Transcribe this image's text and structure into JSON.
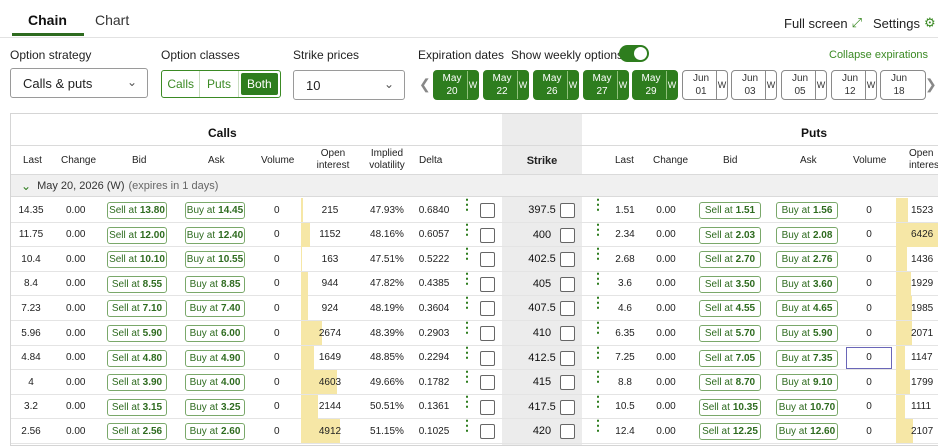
{
  "tabs": [
    {
      "label": "Chain"
    },
    {
      "label": "Chart"
    }
  ],
  "header": {
    "fullscreen_label": "Full screen",
    "settings_label": "Settings"
  },
  "controls": {
    "option_strategy_label": "Option strategy",
    "option_strategy_value": "Calls & puts",
    "option_classes_label": "Option classes",
    "classes": [
      "Calls",
      "Puts",
      "Both"
    ],
    "strike_prices_label": "Strike prices",
    "strike_prices_value": "10",
    "expiration_dates_label": "Expiration dates",
    "weekly_label": "Show weekly options",
    "collapse_label": "Collapse expirations"
  },
  "expirations": [
    {
      "m": "May",
      "d": "20",
      "w": "W",
      "selected": true
    },
    {
      "m": "May",
      "d": "22",
      "w": "W",
      "selected": true
    },
    {
      "m": "May",
      "d": "26",
      "w": "W",
      "selected": true
    },
    {
      "m": "May",
      "d": "27",
      "w": "W",
      "selected": true
    },
    {
      "m": "May",
      "d": "29",
      "w": "W",
      "selected": true
    },
    {
      "m": "Jun",
      "d": "01",
      "w": "W",
      "selected": false
    },
    {
      "m": "Jun",
      "d": "03",
      "w": "W",
      "selected": false
    },
    {
      "m": "Jun",
      "d": "05",
      "w": "W",
      "selected": false
    },
    {
      "m": "Jun",
      "d": "12",
      "w": "W",
      "selected": false
    },
    {
      "m": "Jun",
      "d": "18",
      "w": "",
      "selected": false
    }
  ],
  "table": {
    "calls_label": "Calls",
    "puts_label": "Puts",
    "headers": {
      "last": "Last",
      "change": "Change",
      "bid": "Bid",
      "ask": "Ask",
      "volume": "Volume",
      "oi_1": "Open",
      "oi_2": "interest",
      "iv_1": "Implied",
      "iv_2": "volatility",
      "delta": "Delta",
      "strike": "Strike",
      "p_last": "Last",
      "p_change": "Change",
      "p_bid": "Bid",
      "p_ask": "Ask",
      "p_volume": "Volume",
      "p_oi_1": "Open",
      "p_oi_2": "interest"
    },
    "expiry_title": "May 20, 2026 (W)",
    "expiry_note": "(expires in 1 days)",
    "sell_prefix": "Sell at",
    "buy_prefix": "Buy at",
    "rows": [
      {
        "c_last": "14.35",
        "c_chg": "0.00",
        "c_bid": "13.80",
        "c_ask": "14.45",
        "c_vol": "0",
        "c_oi": "215",
        "c_iv": "47.93%",
        "c_delta": "0.6840",
        "strike": "397.5",
        "p_last": "1.51",
        "p_chg": "0.00",
        "p_bid": "1.51",
        "p_ask": "1.56",
        "p_vol": "0",
        "p_oi": "1523"
      },
      {
        "c_last": "11.75",
        "c_chg": "0.00",
        "c_bid": "12.00",
        "c_ask": "12.40",
        "c_vol": "0",
        "c_oi": "1152",
        "c_iv": "48.16%",
        "c_delta": "0.6057",
        "strike": "400",
        "p_last": "2.34",
        "p_chg": "0.00",
        "p_bid": "2.03",
        "p_ask": "2.08",
        "p_vol": "0",
        "p_oi": "6426"
      },
      {
        "c_last": "10.4",
        "c_chg": "0.00",
        "c_bid": "10.10",
        "c_ask": "10.55",
        "c_vol": "0",
        "c_oi": "163",
        "c_iv": "47.51%",
        "c_delta": "0.5222",
        "strike": "402.5",
        "p_last": "2.68",
        "p_chg": "0.00",
        "p_bid": "2.70",
        "p_ask": "2.76",
        "p_vol": "0",
        "p_oi": "1436"
      },
      {
        "c_last": "8.4",
        "c_chg": "0.00",
        "c_bid": "8.55",
        "c_ask": "8.85",
        "c_vol": "0",
        "c_oi": "944",
        "c_iv": "47.82%",
        "c_delta": "0.4385",
        "strike": "405",
        "p_last": "3.6",
        "p_chg": "0.00",
        "p_bid": "3.50",
        "p_ask": "3.60",
        "p_vol": "0",
        "p_oi": "1929"
      },
      {
        "c_last": "7.23",
        "c_chg": "0.00",
        "c_bid": "7.10",
        "c_ask": "7.40",
        "c_vol": "0",
        "c_oi": "924",
        "c_iv": "48.19%",
        "c_delta": "0.3604",
        "strike": "407.5",
        "p_last": "4.6",
        "p_chg": "0.00",
        "p_bid": "4.55",
        "p_ask": "4.65",
        "p_vol": "0",
        "p_oi": "1985"
      },
      {
        "c_last": "5.96",
        "c_chg": "0.00",
        "c_bid": "5.90",
        "c_ask": "6.00",
        "c_vol": "0",
        "c_oi": "2674",
        "c_iv": "48.39%",
        "c_delta": "0.2903",
        "strike": "410",
        "p_last": "6.35",
        "p_chg": "0.00",
        "p_bid": "5.70",
        "p_ask": "5.90",
        "p_vol": "0",
        "p_oi": "2071"
      },
      {
        "c_last": "4.84",
        "c_chg": "0.00",
        "c_bid": "4.80",
        "c_ask": "4.90",
        "c_vol": "0",
        "c_oi": "1649",
        "c_iv": "48.85%",
        "c_delta": "0.2294",
        "strike": "412.5",
        "p_last": "7.25",
        "p_chg": "0.00",
        "p_bid": "7.05",
        "p_ask": "7.35",
        "p_vol": "0",
        "p_oi": "1147"
      },
      {
        "c_last": "4",
        "c_chg": "0.00",
        "c_bid": "3.90",
        "c_ask": "4.00",
        "c_vol": "0",
        "c_oi": "4603",
        "c_iv": "49.66%",
        "c_delta": "0.1782",
        "strike": "415",
        "p_last": "8.8",
        "p_chg": "0.00",
        "p_bid": "8.70",
        "p_ask": "9.10",
        "p_vol": "0",
        "p_oi": "1799"
      },
      {
        "c_last": "3.2",
        "c_chg": "0.00",
        "c_bid": "3.15",
        "c_ask": "3.25",
        "c_vol": "0",
        "c_oi": "2144",
        "c_iv": "50.51%",
        "c_delta": "0.1361",
        "strike": "417.5",
        "p_last": "10.5",
        "p_chg": "0.00",
        "p_bid": "10.35",
        "p_ask": "10.70",
        "p_vol": "0",
        "p_oi": "1111"
      },
      {
        "c_last": "2.56",
        "c_chg": "0.00",
        "c_bid": "2.56",
        "c_ask": "2.60",
        "c_vol": "0",
        "c_oi": "4912",
        "c_iv": "51.15%",
        "c_delta": "0.1025",
        "strike": "420",
        "p_last": "12.4",
        "p_chg": "0.00",
        "p_bid": "12.25",
        "p_ask": "12.60",
        "p_vol": "0",
        "p_oi": "2107"
      }
    ]
  },
  "colors": {
    "accent": "#2e7d1e",
    "oi_bar": "#f6e7a6",
    "strike_band": "#ececec"
  }
}
